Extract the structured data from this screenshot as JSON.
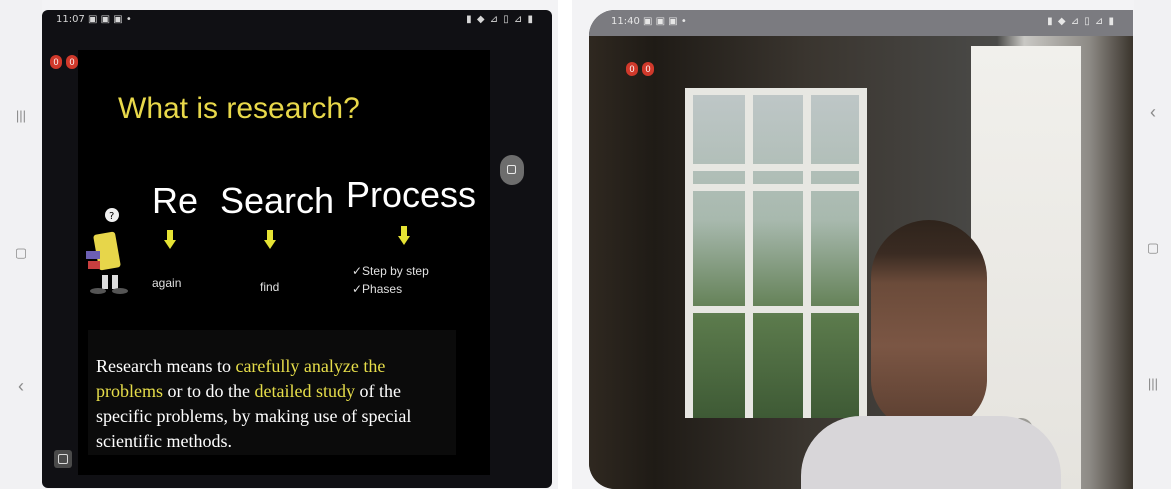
{
  "left": {
    "status_time": "11:07",
    "status_left_icons": "▣ ▣ ▣ •",
    "status_right_icons": "▮ ◆ ⊿ ▯ ⊿ ▮",
    "nav_icons": [
      "recent-apps-icon",
      "home-icon",
      "back-icon"
    ],
    "nav_glyphs": {
      "recent": "|||",
      "home": "▢",
      "back": "‹"
    },
    "rec_badges": [
      "0",
      "0"
    ],
    "slide": {
      "title": "What is research?",
      "words": [
        {
          "label": "Re",
          "meaning": "again"
        },
        {
          "label": "Search",
          "meaning": "find"
        },
        {
          "label": "Process",
          "meaning_lines": [
            "✓Step by step",
            "✓Phases"
          ]
        }
      ],
      "definition": {
        "part1": "Research means to ",
        "hl1": "carefully analyze the problems",
        "part2": " or to do the ",
        "hl2": "detailed study",
        "part3": " of the specific problems, by making use of special scientific methods."
      },
      "colors": {
        "title": "#e8d84a",
        "highlight": "#e7de4a",
        "arrow": "#e6e334",
        "background": "#000000"
      }
    }
  },
  "right": {
    "status_time": "11:40",
    "status_left_icons": "▣ ▣ ▣ •",
    "status_right_icons": "▮ ◆ ⊿ ▯ ⊿ ▮",
    "rec_badges": [
      "0",
      "0"
    ],
    "nav_icons": [
      "back-icon",
      "home-icon",
      "recent-apps-icon"
    ],
    "nav_glyphs": {
      "back": "‹",
      "home": "▢",
      "recent": "|||"
    }
  }
}
